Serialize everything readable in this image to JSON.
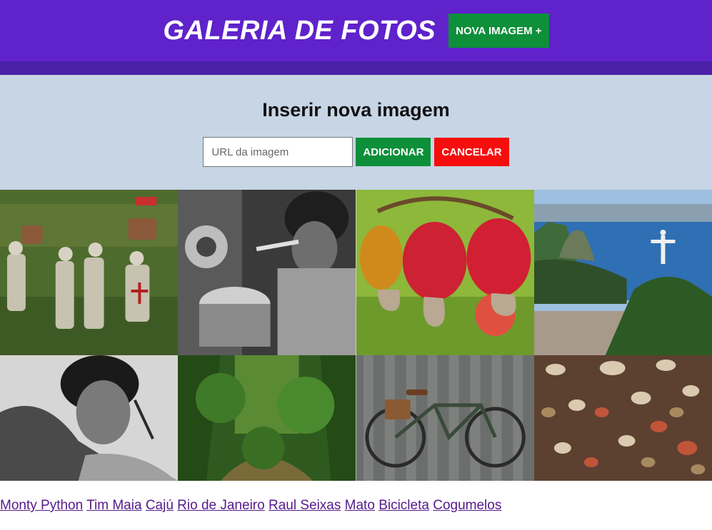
{
  "header": {
    "title": "GALERIA DE FOTOS",
    "new_button_label": "NOVA IMAGEM +"
  },
  "form": {
    "heading": "Inserir nova imagem",
    "url_placeholder": "URL da imagem",
    "url_value": "",
    "add_label": "ADICIONAR",
    "cancel_label": "CANCELAR"
  },
  "gallery": {
    "links": [
      "Monty Python",
      "Tim Maia",
      "Cajú",
      "Rio de Janeiro",
      "Raul Seixas",
      "Mato",
      "Bicicleta",
      "Cogumelos"
    ]
  },
  "colors": {
    "header": "#5f22cb",
    "header_strip": "#4920a6",
    "panel": "#c7d5e5",
    "green_button": "#0e8f3a",
    "red_button": "#f70d0d",
    "link": "#551a8b"
  }
}
